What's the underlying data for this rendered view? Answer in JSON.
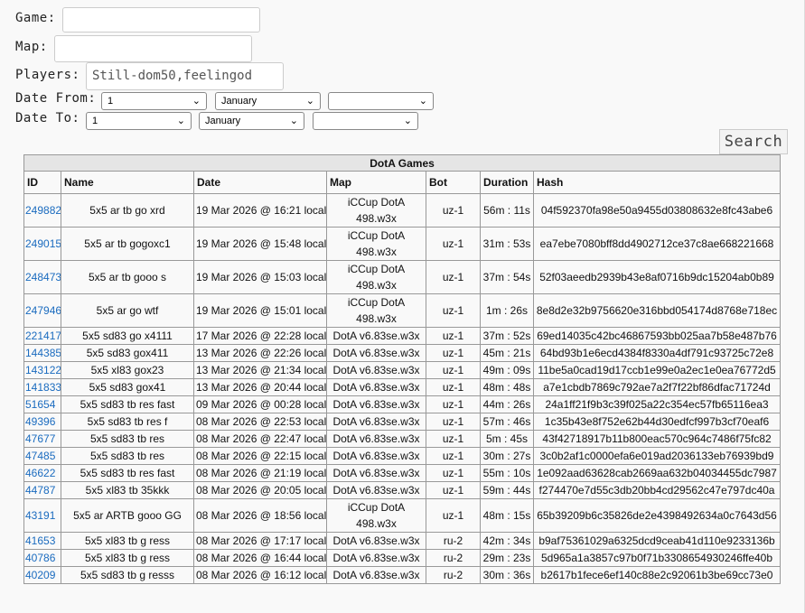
{
  "form": {
    "game_label": "Game:",
    "game_value": "",
    "map_label": "Map:",
    "map_value": "",
    "players_label": "Players:",
    "players_value": "Still-dom50,feelingod",
    "date_from_label": "Date From:",
    "date_from_day": "1",
    "date_from_month": "January",
    "date_from_year": "",
    "date_to_label": "Date To:",
    "date_to_day": "1",
    "date_to_month": "January",
    "date_to_year": "",
    "search_label": "Search"
  },
  "table": {
    "caption": "DotA Games",
    "headers": [
      "ID",
      "Name",
      "Date",
      "Map",
      "Bot",
      "Duration",
      "Hash"
    ],
    "rows": [
      {
        "id": "249882",
        "name": "5x5 ar tb go xrd",
        "date": "19 Mar 2026 @ 16:21 local",
        "map": "iCCup DotA 498.w3x",
        "bot": "uz-1",
        "duration": "56m : 11s",
        "hash": "04f592370fa98e50a9455d03808632e8fc43abe6",
        "tall": true
      },
      {
        "id": "249015",
        "name": "5x5 ar tb gogoxc1",
        "date": "19 Mar 2026 @ 15:48 local",
        "map": "iCCup DotA 498.w3x",
        "bot": "uz-1",
        "duration": "31m : 53s",
        "hash": "ea7ebe7080bff8dd4902712ce37c8ae668221668",
        "tall": true
      },
      {
        "id": "248473",
        "name": "5x5 ar tb gooo s",
        "date": "19 Mar 2026 @ 15:03 local",
        "map": "iCCup DotA 498.w3x",
        "bot": "uz-1",
        "duration": "37m : 54s",
        "hash": "52f03aeedb2939b43e8af0716b9dc15204ab0b89",
        "tall": true
      },
      {
        "id": "247946",
        "name": "5x5 ar go wtf",
        "date": "19 Mar 2026 @ 15:01 local",
        "map": "iCCup DotA 498.w3x",
        "bot": "uz-1",
        "duration": "1m : 26s",
        "hash": "8e8d2e32b9756620e316bbd054174d8768e718ec",
        "tall": true
      },
      {
        "id": "221417",
        "name": "5x5 sd83 go x4111",
        "date": "17 Mar 2026 @ 22:28 local",
        "map": "DotA v6.83se.w3x",
        "bot": "uz-1",
        "duration": "37m : 52s",
        "hash": "69ed14035c42bc46867593bb025aa7b58e487b76",
        "tall": false
      },
      {
        "id": "144385",
        "name": "5x5 sd83 gox411",
        "date": "13 Mar 2026 @ 22:26 local",
        "map": "DotA v6.83se.w3x",
        "bot": "uz-1",
        "duration": "45m : 21s",
        "hash": "64bd93b1e6ecd4384f8330a4df791c93725c72e8",
        "tall": false
      },
      {
        "id": "143122",
        "name": "5x5 xl83 gox23",
        "date": "13 Mar 2026 @ 21:34 local",
        "map": "DotA v6.83se.w3x",
        "bot": "uz-1",
        "duration": "49m : 09s",
        "hash": "11be5a0cad19d17ccb1e99e0a2ec1e0ea76772d5",
        "tall": false
      },
      {
        "id": "141833",
        "name": "5x5 sd83 gox41",
        "date": "13 Mar 2026 @ 20:44 local",
        "map": "DotA v6.83se.w3x",
        "bot": "uz-1",
        "duration": "48m : 48s",
        "hash": "a7e1cbdb7869c792ae7a2f7f22bf86dfac71724d",
        "tall": false
      },
      {
        "id": "51654",
        "name": "5x5 sd83 tb res fast",
        "date": "09 Mar 2026 @ 00:28 local",
        "map": "DotA v6.83se.w3x",
        "bot": "uz-1",
        "duration": "44m : 26s",
        "hash": "24a1ff21f9b3c39f025a22c354ec57fb65116ea3",
        "tall": false
      },
      {
        "id": "49396",
        "name": "5x5 sd83 tb res f",
        "date": "08 Mar 2026 @ 22:53 local",
        "map": "DotA v6.83se.w3x",
        "bot": "uz-1",
        "duration": "57m : 46s",
        "hash": "1c35b43e8f752e62b44d30edfcf997b3cf70eaf6",
        "tall": false
      },
      {
        "id": "47677",
        "name": "5x5 sd83 tb res",
        "date": "08 Mar 2026 @ 22:47 local",
        "map": "DotA v6.83se.w3x",
        "bot": "uz-1",
        "duration": "5m : 45s",
        "hash": "43f42718917b11b800eac570c964c7486f75fc82",
        "tall": false
      },
      {
        "id": "47485",
        "name": "5x5 sd83 tb res",
        "date": "08 Mar 2026 @ 22:15 local",
        "map": "DotA v6.83se.w3x",
        "bot": "uz-1",
        "duration": "30m : 27s",
        "hash": "3c0b2af1c0000efa6e019ad2036133eb76939bd9",
        "tall": false
      },
      {
        "id": "46622",
        "name": "5x5 sd83 tb res fast",
        "date": "08 Mar 2026 @ 21:19 local",
        "map": "DotA v6.83se.w3x",
        "bot": "uz-1",
        "duration": "55m : 10s",
        "hash": "1e092aad63628cab2669aa632b04034455dc7987",
        "tall": false
      },
      {
        "id": "44787",
        "name": "5x5 xl83 tb 35kkk",
        "date": "08 Mar 2026 @ 20:05 local",
        "map": "DotA v6.83se.w3x",
        "bot": "uz-1",
        "duration": "59m : 44s",
        "hash": "f274470e7d55c3db20bb4cd29562c47e797dc40a",
        "tall": false
      },
      {
        "id": "43191",
        "name": "5x5 ar ARTB gooo GG",
        "date": "08 Mar 2026 @ 18:56 local",
        "map": "iCCup DotA 498.w3x",
        "bot": "uz-1",
        "duration": "48m : 15s",
        "hash": "65b39209b6c35826de2e4398492634a0c7643d56",
        "tall": true
      },
      {
        "id": "41653",
        "name": "5x5 xl83 tb g ress",
        "date": "08 Mar 2026 @ 17:17 local",
        "map": "DotA v6.83se.w3x",
        "bot": "ru-2",
        "duration": "42m : 34s",
        "hash": "b9af75361029a6325dcd9ceab41d110e9233136b",
        "tall": false
      },
      {
        "id": "40786",
        "name": "5x5 xl83 tb g ress",
        "date": "08 Mar 2026 @ 16:44 local",
        "map": "DotA v6.83se.w3x",
        "bot": "ru-2",
        "duration": "29m : 23s",
        "hash": "5d965a1a3857c97b0f71b3308654930246ffe40b",
        "tall": false
      },
      {
        "id": "40209",
        "name": "5x5 sd83 tb g resss",
        "date": "08 Mar 2026 @ 16:12 local",
        "map": "DotA v6.83se.w3x",
        "bot": "ru-2",
        "duration": "30m : 36s",
        "hash": "b2617b1fece6ef140c88e2c92061b3be69cc73e0",
        "tall": false
      }
    ]
  }
}
